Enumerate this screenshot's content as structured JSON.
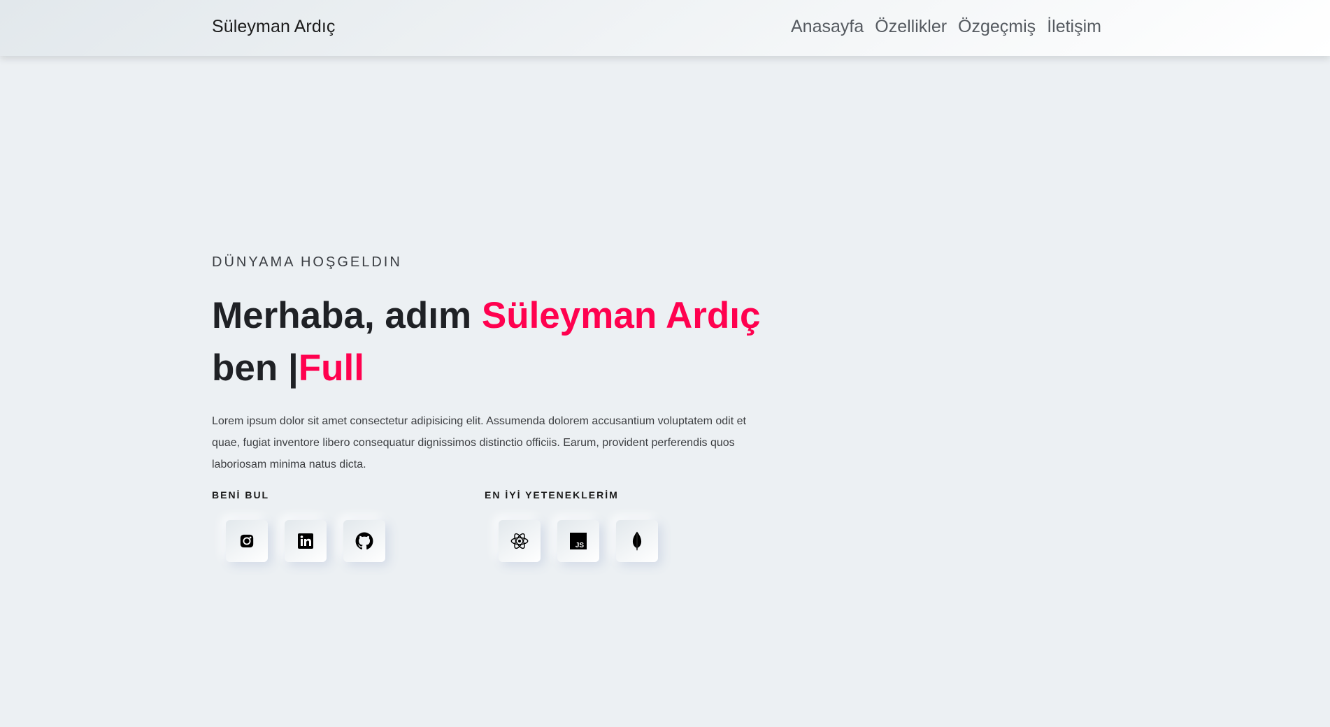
{
  "nav": {
    "brand": "Süleyman Ardıç",
    "links": [
      "Anasayfa",
      "Özellikler",
      "Özgeçmiş",
      "İletişim"
    ]
  },
  "hero": {
    "subtitle": "DÜNYAMA HOŞGELDIN",
    "headline_prefix": "Merhaba, adım ",
    "headline_name": "Süleyman Ardıç",
    "headline_line2_prefix": "ben |",
    "headline_role": "Full",
    "description": "Lorem ipsum dolor sit amet consectetur adipisicing elit. Assumenda dolorem accusantium voluptatem odit et quae, fugiat inventore libero consequatur dignissimos distinctio officiis. Earum, provident perferendis quos laboriosam minima natus dicta."
  },
  "social": {
    "label": "BENİ BUL",
    "icons": [
      "instagram-icon",
      "linkedin-icon",
      "github-icon"
    ]
  },
  "skills": {
    "label": "EN İYİ YETENEKLERİM",
    "icons": [
      "react-icon",
      "javascript-icon",
      "mongodb-icon"
    ]
  },
  "colors": {
    "accent": "#ff014f",
    "background": "#ecf0f3",
    "text": "#1f2125"
  }
}
